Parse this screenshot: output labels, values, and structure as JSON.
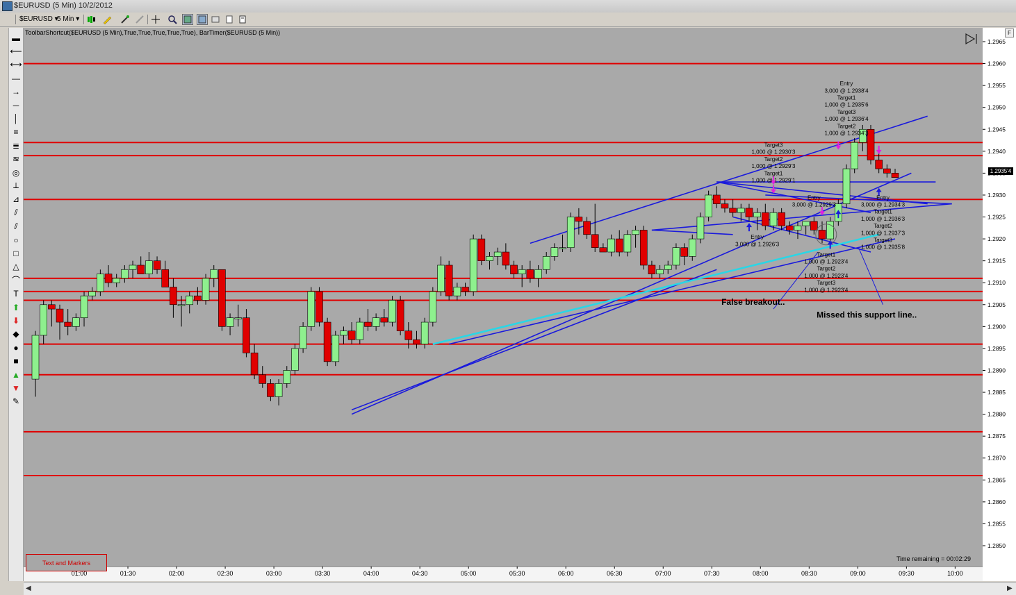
{
  "window": {
    "title": "$EURUSD (5 Min)  10/2/2012"
  },
  "toolbar": {
    "symbol": "$EURUSD",
    "interval": "5 Min"
  },
  "indicator_line": "ToolbarShortcut($EURUSD (5 Min),True,True,True,True,True), BarTimer($EURUSD (5 Min))",
  "text_markers_label": "Text and Markers",
  "time_remaining": "Time remaining = 00:02:29",
  "bar_timer_label": "1.2935'4",
  "f_button": "F",
  "colors": {
    "chart_bg": "#a9a9a9",
    "up_candle": "#8ef08e",
    "down_candle": "#e00000",
    "sr_line": "#e00000",
    "trend_line": "#1a1adc",
    "cyan_line": "#2ad6e6",
    "magenta_arrow": "#e020e0"
  },
  "sidebar_tools": [
    "ruler-icon",
    "ray-left-icon",
    "ray-both-icon",
    "segment-icon",
    "arrow-right-icon",
    "horizontal-line-icon",
    "vertical-line-icon",
    "parallel-lines-icon",
    "fib-icon",
    "fib-fan-icon",
    "cycle-icon",
    "pitchfork-icon",
    "gann-icon",
    "channel-icon",
    "channel2-icon",
    "circle-icon",
    "rectangle-icon",
    "triangle-icon",
    "arc-icon",
    "text-icon",
    "arrow-up-icon",
    "arrow-down-icon",
    "diamond-icon",
    "dot-icon",
    "square-icon",
    "triangle-up-icon",
    "triangle-down-icon",
    "eraser-icon"
  ],
  "chart_data": {
    "type": "candlestick",
    "price_range": [
      1.2843,
      1.2971
    ],
    "y_ticks": [
      "1.2965",
      "1.2960",
      "1.2955",
      "1.2950",
      "1.2945",
      "1.2940",
      "1.2935",
      "1.2930",
      "1.2925",
      "1.2920",
      "1.2915",
      "1.2910",
      "1.2905",
      "1.2900",
      "1.2895",
      "1.2890",
      "1.2885",
      "1.2880",
      "1.2875",
      "1.2870",
      "1.2865",
      "1.2860",
      "1.2855",
      "1.2850"
    ],
    "x_ticks": [
      "01:00",
      "01:30",
      "02:00",
      "02:30",
      "03:00",
      "03:30",
      "04:00",
      "04:30",
      "05:00",
      "05:30",
      "06:00",
      "06:30",
      "07:00",
      "07:30",
      "08:00",
      "08:30",
      "09:00",
      "09:30",
      "10:00"
    ],
    "horizontal_levels": [
      1.296,
      1.2942,
      1.2939,
      1.2929,
      1.2911,
      1.2908,
      1.2906,
      1.2896,
      1.2889,
      1.2876,
      1.2866
    ],
    "candles": [
      {
        "o": 1.2888,
        "h": 1.2899,
        "l": 1.2884,
        "c": 1.2898
      },
      {
        "o": 1.2898,
        "h": 1.2906,
        "l": 1.2896,
        "c": 1.2905
      },
      {
        "o": 1.2905,
        "h": 1.2906,
        "l": 1.29,
        "c": 1.2904
      },
      {
        "o": 1.2904,
        "h": 1.2905,
        "l": 1.2897,
        "c": 1.2901
      },
      {
        "o": 1.2901,
        "h": 1.2904,
        "l": 1.2898,
        "c": 1.29
      },
      {
        "o": 1.29,
        "h": 1.2903,
        "l": 1.2899,
        "c": 1.2902
      },
      {
        "o": 1.2902,
        "h": 1.2908,
        "l": 1.29,
        "c": 1.2907
      },
      {
        "o": 1.2907,
        "h": 1.2909,
        "l": 1.2906,
        "c": 1.2908
      },
      {
        "o": 1.2908,
        "h": 1.2913,
        "l": 1.2907,
        "c": 1.2912
      },
      {
        "o": 1.2912,
        "h": 1.2914,
        "l": 1.2909,
        "c": 1.291
      },
      {
        "o": 1.291,
        "h": 1.2912,
        "l": 1.2909,
        "c": 1.2911
      },
      {
        "o": 1.2911,
        "h": 1.2914,
        "l": 1.291,
        "c": 1.2913
      },
      {
        "o": 1.2913,
        "h": 1.2915,
        "l": 1.2911,
        "c": 1.2914
      },
      {
        "o": 1.2914,
        "h": 1.2916,
        "l": 1.2912,
        "c": 1.2912
      },
      {
        "o": 1.2912,
        "h": 1.2917,
        "l": 1.2911,
        "c": 1.2915
      },
      {
        "o": 1.2915,
        "h": 1.2916,
        "l": 1.2912,
        "c": 1.2913
      },
      {
        "o": 1.2913,
        "h": 1.2915,
        "l": 1.2911,
        "c": 1.2909
      },
      {
        "o": 1.2909,
        "h": 1.2911,
        "l": 1.2902,
        "c": 1.2905
      },
      {
        "o": 1.2905,
        "h": 1.2907,
        "l": 1.29,
        "c": 1.2905
      },
      {
        "o": 1.2905,
        "h": 1.2908,
        "l": 1.2903,
        "c": 1.2907
      },
      {
        "o": 1.2907,
        "h": 1.2909,
        "l": 1.2905,
        "c": 1.2906
      },
      {
        "o": 1.2906,
        "h": 1.2912,
        "l": 1.2905,
        "c": 1.2911
      },
      {
        "o": 1.2911,
        "h": 1.2914,
        "l": 1.2909,
        "c": 1.2913
      },
      {
        "o": 1.2913,
        "h": 1.2913,
        "l": 1.2899,
        "c": 1.29
      },
      {
        "o": 1.29,
        "h": 1.2903,
        "l": 1.2898,
        "c": 1.2902
      },
      {
        "o": 1.2902,
        "h": 1.2905,
        "l": 1.29,
        "c": 1.2902
      },
      {
        "o": 1.2902,
        "h": 1.2904,
        "l": 1.2893,
        "c": 1.2894
      },
      {
        "o": 1.2894,
        "h": 1.2896,
        "l": 1.2888,
        "c": 1.2889
      },
      {
        "o": 1.2889,
        "h": 1.2891,
        "l": 1.2886,
        "c": 1.2887
      },
      {
        "o": 1.2887,
        "h": 1.2888,
        "l": 1.2883,
        "c": 1.2884
      },
      {
        "o": 1.2884,
        "h": 1.2888,
        "l": 1.2882,
        "c": 1.2887
      },
      {
        "o": 1.2887,
        "h": 1.2891,
        "l": 1.2886,
        "c": 1.289
      },
      {
        "o": 1.289,
        "h": 1.2896,
        "l": 1.2889,
        "c": 1.2895
      },
      {
        "o": 1.2895,
        "h": 1.2901,
        "l": 1.2894,
        "c": 1.29
      },
      {
        "o": 1.29,
        "h": 1.2909,
        "l": 1.2899,
        "c": 1.2908
      },
      {
        "o": 1.2908,
        "h": 1.2909,
        "l": 1.29,
        "c": 1.2901
      },
      {
        "o": 1.2901,
        "h": 1.2902,
        "l": 1.2891,
        "c": 1.2892
      },
      {
        "o": 1.2892,
        "h": 1.2899,
        "l": 1.2891,
        "c": 1.2898
      },
      {
        "o": 1.2898,
        "h": 1.29,
        "l": 1.2896,
        "c": 1.2899
      },
      {
        "o": 1.2899,
        "h": 1.2901,
        "l": 1.2896,
        "c": 1.2897
      },
      {
        "o": 1.2897,
        "h": 1.2902,
        "l": 1.2896,
        "c": 1.2901
      },
      {
        "o": 1.2901,
        "h": 1.2904,
        "l": 1.2899,
        "c": 1.29
      },
      {
        "o": 1.29,
        "h": 1.2903,
        "l": 1.2899,
        "c": 1.2902
      },
      {
        "o": 1.2902,
        "h": 1.2904,
        "l": 1.29,
        "c": 1.2901
      },
      {
        "o": 1.2901,
        "h": 1.2907,
        "l": 1.29,
        "c": 1.2906
      },
      {
        "o": 1.2906,
        "h": 1.2907,
        "l": 1.2898,
        "c": 1.2899
      },
      {
        "o": 1.2899,
        "h": 1.2901,
        "l": 1.2895,
        "c": 1.2897
      },
      {
        "o": 1.2897,
        "h": 1.2899,
        "l": 1.2895,
        "c": 1.2896
      },
      {
        "o": 1.2896,
        "h": 1.2902,
        "l": 1.2895,
        "c": 1.2901
      },
      {
        "o": 1.2901,
        "h": 1.2909,
        "l": 1.29,
        "c": 1.2908
      },
      {
        "o": 1.2908,
        "h": 1.2916,
        "l": 1.2907,
        "c": 1.2914
      },
      {
        "o": 1.2914,
        "h": 1.2915,
        "l": 1.2906,
        "c": 1.2907
      },
      {
        "o": 1.2907,
        "h": 1.291,
        "l": 1.2906,
        "c": 1.2909
      },
      {
        "o": 1.2909,
        "h": 1.291,
        "l": 1.2907,
        "c": 1.2908
      },
      {
        "o": 1.2908,
        "h": 1.2921,
        "l": 1.2907,
        "c": 1.292
      },
      {
        "o": 1.292,
        "h": 1.2921,
        "l": 1.2914,
        "c": 1.2915
      },
      {
        "o": 1.2915,
        "h": 1.2917,
        "l": 1.2913,
        "c": 1.2916
      },
      {
        "o": 1.2916,
        "h": 1.2918,
        "l": 1.2914,
        "c": 1.2917
      },
      {
        "o": 1.2917,
        "h": 1.2919,
        "l": 1.2913,
        "c": 1.2914
      },
      {
        "o": 1.2914,
        "h": 1.2915,
        "l": 1.2911,
        "c": 1.2912
      },
      {
        "o": 1.2912,
        "h": 1.2914,
        "l": 1.2909,
        "c": 1.2913
      },
      {
        "o": 1.2913,
        "h": 1.2915,
        "l": 1.291,
        "c": 1.2911
      },
      {
        "o": 1.2911,
        "h": 1.2914,
        "l": 1.2909,
        "c": 1.2913
      },
      {
        "o": 1.2913,
        "h": 1.2917,
        "l": 1.2912,
        "c": 1.2916
      },
      {
        "o": 1.2916,
        "h": 1.2919,
        "l": 1.2915,
        "c": 1.2918
      },
      {
        "o": 1.2918,
        "h": 1.2921,
        "l": 1.2917,
        "c": 1.2918
      },
      {
        "o": 1.2918,
        "h": 1.2926,
        "l": 1.2917,
        "c": 1.2925
      },
      {
        "o": 1.2925,
        "h": 1.2927,
        "l": 1.2921,
        "c": 1.2924
      },
      {
        "o": 1.2924,
        "h": 1.2925,
        "l": 1.292,
        "c": 1.2921
      },
      {
        "o": 1.2921,
        "h": 1.2928,
        "l": 1.2917,
        "c": 1.2918
      },
      {
        "o": 1.2918,
        "h": 1.2919,
        "l": 1.2917,
        "c": 1.2917
      },
      {
        "o": 1.2917,
        "h": 1.2921,
        "l": 1.2916,
        "c": 1.292
      },
      {
        "o": 1.292,
        "h": 1.2922,
        "l": 1.2916,
        "c": 1.2917
      },
      {
        "o": 1.2917,
        "h": 1.2922,
        "l": 1.2916,
        "c": 1.2921
      },
      {
        "o": 1.2921,
        "h": 1.2923,
        "l": 1.2918,
        "c": 1.2922
      },
      {
        "o": 1.2922,
        "h": 1.2923,
        "l": 1.2913,
        "c": 1.2914
      },
      {
        "o": 1.2914,
        "h": 1.2915,
        "l": 1.2911,
        "c": 1.2912
      },
      {
        "o": 1.2912,
        "h": 1.2914,
        "l": 1.2911,
        "c": 1.2913
      },
      {
        "o": 1.2913,
        "h": 1.2915,
        "l": 1.2912,
        "c": 1.2914
      },
      {
        "o": 1.2914,
        "h": 1.2919,
        "l": 1.2913,
        "c": 1.2918
      },
      {
        "o": 1.2918,
        "h": 1.2919,
        "l": 1.2914,
        "c": 1.2916
      },
      {
        "o": 1.2916,
        "h": 1.2921,
        "l": 1.2915,
        "c": 1.292
      },
      {
        "o": 1.292,
        "h": 1.2926,
        "l": 1.2919,
        "c": 1.2925
      },
      {
        "o": 1.2925,
        "h": 1.2931,
        "l": 1.2924,
        "c": 1.293
      },
      {
        "o": 1.293,
        "h": 1.2932,
        "l": 1.2927,
        "c": 1.2928
      },
      {
        "o": 1.2928,
        "h": 1.2929,
        "l": 1.2926,
        "c": 1.2927
      },
      {
        "o": 1.2927,
        "h": 1.2929,
        "l": 1.2925,
        "c": 1.2926
      },
      {
        "o": 1.2926,
        "h": 1.2928,
        "l": 1.2924,
        "c": 1.2927
      },
      {
        "o": 1.2927,
        "h": 1.2928,
        "l": 1.2924,
        "c": 1.2925
      },
      {
        "o": 1.2925,
        "h": 1.2927,
        "l": 1.2922,
        "c": 1.2926
      },
      {
        "o": 1.2926,
        "h": 1.2928,
        "l": 1.2922,
        "c": 1.2923
      },
      {
        "o": 1.2923,
        "h": 1.2927,
        "l": 1.2922,
        "c": 1.2926
      },
      {
        "o": 1.2926,
        "h": 1.2927,
        "l": 1.2922,
        "c": 1.2923
      },
      {
        "o": 1.2923,
        "h": 1.2924,
        "l": 1.2921,
        "c": 1.2922
      },
      {
        "o": 1.2922,
        "h": 1.2924,
        "l": 1.292,
        "c": 1.2923
      },
      {
        "o": 1.2923,
        "h": 1.2924,
        "l": 1.2921,
        "c": 1.2924
      },
      {
        "o": 1.2924,
        "h": 1.2925,
        "l": 1.2921,
        "c": 1.2922
      },
      {
        "o": 1.2922,
        "h": 1.2924,
        "l": 1.2919,
        "c": 1.292
      },
      {
        "o": 1.292,
        "h": 1.2925,
        "l": 1.2919,
        "c": 1.2924
      },
      {
        "o": 1.2924,
        "h": 1.2929,
        "l": 1.2923,
        "c": 1.2928
      },
      {
        "o": 1.2928,
        "h": 1.2937,
        "l": 1.2927,
        "c": 1.2936
      },
      {
        "o": 1.2936,
        "h": 1.2943,
        "l": 1.2935,
        "c": 1.2942
      },
      {
        "o": 1.2942,
        "h": 1.2946,
        "l": 1.294,
        "c": 1.2945
      },
      {
        "o": 1.2945,
        "h": 1.2946,
        "l": 1.2937,
        "c": 1.2938
      },
      {
        "o": 1.2938,
        "h": 1.294,
        "l": 1.2935,
        "c": 1.2936
      },
      {
        "o": 1.2936,
        "h": 1.2937,
        "l": 1.2934,
        "c": 1.2935
      },
      {
        "o": 1.2935,
        "h": 1.2936,
        "l": 1.2934,
        "c": 1.2934
      }
    ],
    "trend_lines": [
      {
        "from": [
          39,
          1.288
        ],
        "to": [
          108,
          1.2935
        ]
      },
      {
        "from": [
          39,
          1.2881
        ],
        "to": [
          84,
          1.2913
        ]
      },
      {
        "from": [
          51,
          1.2896
        ],
        "to": [
          106,
          1.292
        ]
      },
      {
        "from": [
          61,
          1.2919
        ],
        "to": [
          110,
          1.2948
        ]
      },
      {
        "from": [
          76,
          1.2922
        ],
        "to": [
          86,
          1.2921
        ]
      },
      {
        "from": [
          76,
          1.2922
        ],
        "to": [
          113,
          1.2928
        ]
      },
      {
        "from": [
          86,
          1.2925
        ],
        "to": [
          103,
          1.2917
        ]
      },
      {
        "from": [
          84,
          1.2933
        ],
        "to": [
          110,
          1.2928
        ]
      },
      {
        "from": [
          84,
          1.2933
        ],
        "to": [
          103,
          1.2926
        ]
      },
      {
        "from": [
          84,
          1.2933
        ],
        "to": [
          111,
          1.2933
        ]
      },
      {
        "from": [
          90,
          1.293
        ],
        "to": [
          113,
          1.2928
        ]
      }
    ],
    "cyan_line": {
      "from": [
        49,
        1.2896
      ],
      "to": [
        104,
        1.2921
      ]
    },
    "annotations": [
      {
        "text": "False breakout..",
        "x": 88.5,
        "y": 1.2905
      },
      {
        "text": "Missed this support line..",
        "x": 102.5,
        "y": 1.2902
      }
    ],
    "order_labels": [
      {
        "lines": [
          "Target3",
          "1,000 @ 1.2930'3",
          "Target2",
          "1,000 @ 1.2929'3",
          "Target1",
          "1,000 @ 1.2929'1"
        ],
        "x": 91,
        "y": 1.2941
      },
      {
        "lines": [
          "Entry",
          "3,000 @ 1.2938'4",
          "Target1",
          "1,000 @ 1.2935'6",
          "Target3",
          "1,000 @ 1.2936'4",
          "Target2",
          "1,000 @ 1.2934'3"
        ],
        "x": 100,
        "y": 1.2955
      },
      {
        "lines": [
          "Entry",
          "3,000 @ 1.2929'3"
        ],
        "x": 96,
        "y": 1.2929
      },
      {
        "lines": [
          "Entry",
          "3,000 @ 1.2934'3",
          "Target1",
          "1,000 @ 1.2936'3",
          "Target2",
          "1,000 @ 1.2937'3",
          "Target3",
          "1,000 @ 1.2935'8"
        ],
        "x": 104.5,
        "y": 1.2929
      },
      {
        "lines": [
          "Entry",
          "3,000 @ 1.2926'3"
        ],
        "x": 89,
        "y": 1.292
      },
      {
        "lines": [
          "Target1",
          "1,000 @ 1.2923'4",
          "Target2",
          "1,000 @ 1.2923'4",
          "Target3",
          "1,000 @ 1.2923'4"
        ],
        "x": 97.5,
        "y": 1.2916
      }
    ],
    "marker_arrows": [
      {
        "type": "down",
        "color": "magenta",
        "x": 91,
        "y": 1.2933
      },
      {
        "type": "down",
        "color": "magenta",
        "x": 91,
        "y": 1.2931
      },
      {
        "type": "down",
        "color": "magenta",
        "x": 97,
        "y": 1.2926
      },
      {
        "type": "down",
        "color": "magenta",
        "x": 99,
        "y": 1.2941
      },
      {
        "type": "down",
        "color": "magenta",
        "x": 104,
        "y": 1.294
      },
      {
        "type": "up",
        "color": "blue",
        "x": 88,
        "y": 1.2923
      },
      {
        "type": "up",
        "color": "blue",
        "x": 99,
        "y": 1.2926
      },
      {
        "type": "up",
        "color": "blue",
        "x": 104,
        "y": 1.2931
      },
      {
        "type": "up",
        "color": "blue",
        "x": 98,
        "y": 1.2919
      }
    ]
  }
}
